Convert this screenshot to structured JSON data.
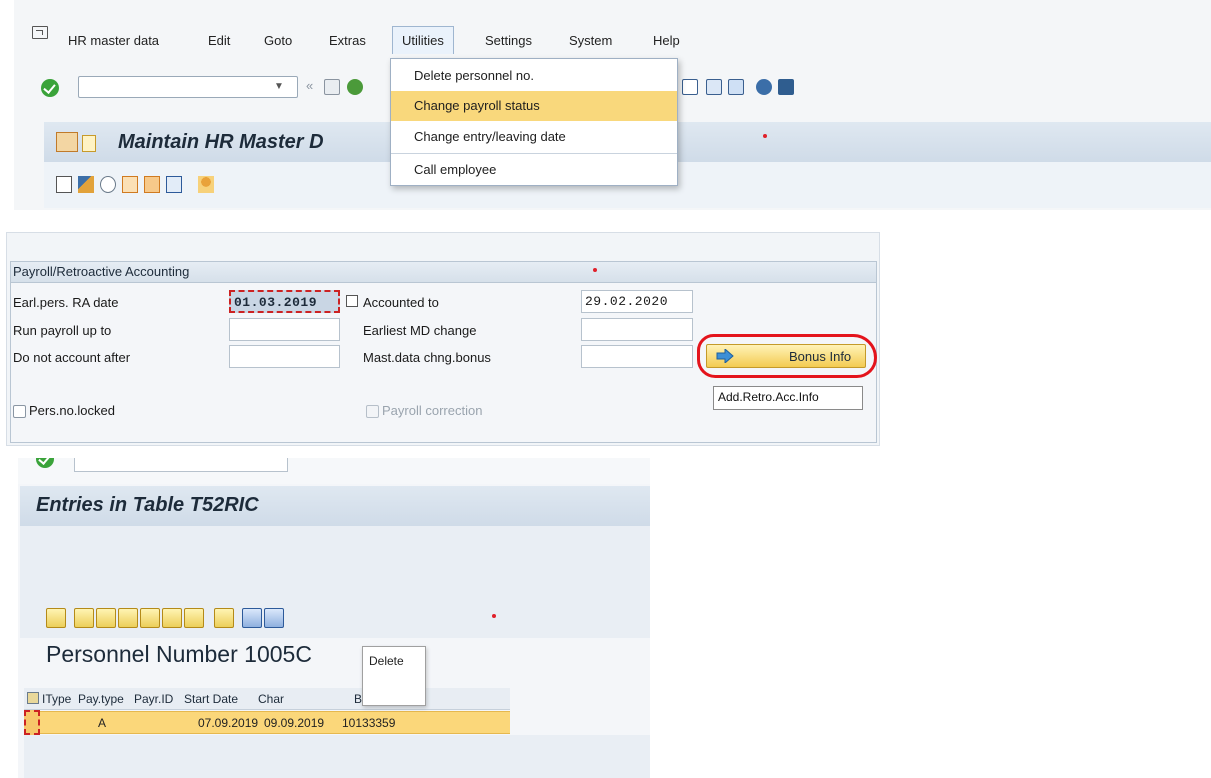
{
  "panel1": {
    "menu": [
      "HR master data",
      "Edit",
      "Goto",
      "Extras",
      "Utilities",
      "Settings",
      "System",
      "Help"
    ],
    "active_menu": "Utilities",
    "utilities_items": [
      "Delete personnel no.",
      "Change payroll status",
      "Change entry/leaving date",
      "Call employee"
    ],
    "highlighted_item": "Change payroll status",
    "title": "Maintain HR Master D"
  },
  "panel2": {
    "group_title": "Payroll/Retroactive Accounting",
    "fields": {
      "earl_pers_ra_date": {
        "label": "Earl.pers. RA date",
        "value": "01.03.2019"
      },
      "run_payroll_up_to": {
        "label": "Run payroll up to",
        "value": ""
      },
      "do_not_account_after": {
        "label": "Do not account after",
        "value": ""
      },
      "accounted_to": {
        "label": "Accounted to",
        "value": "29.02.2020"
      },
      "earliest_md_change": {
        "label": "Earliest MD change",
        "value": ""
      },
      "mast_data_chng_bonus": {
        "label": "Mast.data chng.bonus",
        "value": ""
      }
    },
    "checkboxes": {
      "pers_no_locked": {
        "label": "Pers.no.locked",
        "checked": false
      },
      "payroll_correction": {
        "label": "Payroll correction",
        "checked": false,
        "enabled": false
      }
    },
    "bonus_button": "Bonus Info",
    "tooltip": "Add.Retro.Acc.Info",
    "annotation_color": "#e4141c"
  },
  "panel3": {
    "title": "Entries in Table T52RIC",
    "heading": "Personnel Number 1005C",
    "delete_popup": "Delete",
    "columns": [
      "IType",
      "Pay.type",
      "Payr.ID",
      "Start Date",
      "Char",
      "By"
    ],
    "rows": [
      {
        "itype": "",
        "pay_type": "A",
        "payr_id": "",
        "start_date": "07.09.2019",
        "changed_on": "09.09.2019",
        "by": "10133359"
      }
    ],
    "row_highlight_color": "#fbd77a"
  }
}
